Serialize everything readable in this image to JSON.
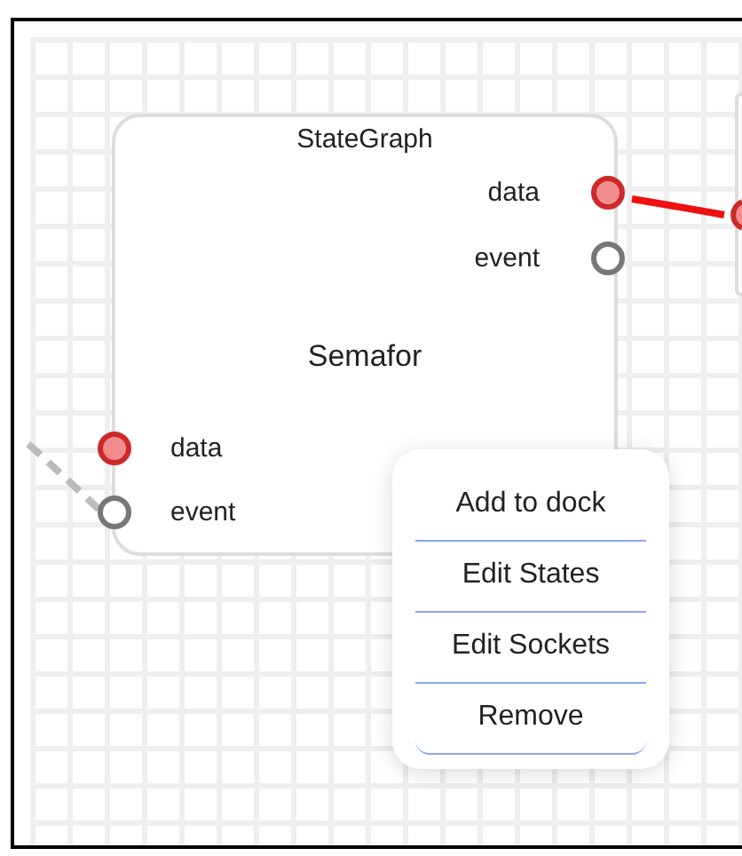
{
  "node": {
    "category": "StateGraph",
    "name": "Semafor",
    "outputs": [
      {
        "label": "data",
        "kind": "data"
      },
      {
        "label": "event",
        "kind": "event"
      }
    ],
    "inputs": [
      {
        "label": "data",
        "kind": "data"
      },
      {
        "label": "event",
        "kind": "event"
      }
    ]
  },
  "context_menu": {
    "items": [
      "Add to dock",
      "Edit States",
      "Edit Sockets",
      "Remove"
    ]
  }
}
